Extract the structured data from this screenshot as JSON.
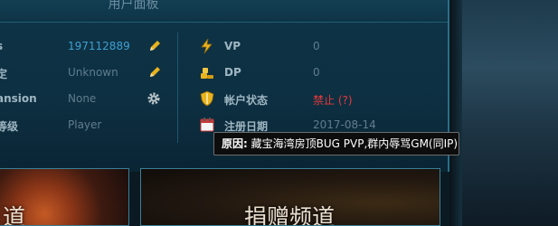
{
  "panel": {
    "title": "用户面板"
  },
  "left_rows": [
    {
      "label": "s",
      "value": "197112889",
      "action_icon": "pencil-icon"
    },
    {
      "label": "定",
      "value": "Unknown",
      "action_icon": "pencil-icon"
    },
    {
      "label": "ansion",
      "value": "None",
      "action_icon": "gear-icon"
    },
    {
      "label": "等级",
      "value": "Player"
    }
  ],
  "right_rows": [
    {
      "label": "VP",
      "value": "0",
      "icon": "lightning-icon"
    },
    {
      "label": "DP",
      "value": "0",
      "icon": "coins-icon"
    },
    {
      "label": "帐户状态",
      "value": "禁止 (?)",
      "icon": "shield-icon"
    },
    {
      "label": "注册日期",
      "value": "2017-08-14",
      "icon": "calendar-icon"
    }
  ],
  "tooltip": {
    "label": "原因:",
    "text": "藏宝海湾房顶BUG PVP,群内辱骂GM(同IP)"
  },
  "banners": {
    "left_text": "道",
    "right_text": "捐赠频道"
  },
  "colors": {
    "link": "#3f9fd0",
    "banned": "#e63a3a",
    "icon_gold": "#e8b31f"
  }
}
